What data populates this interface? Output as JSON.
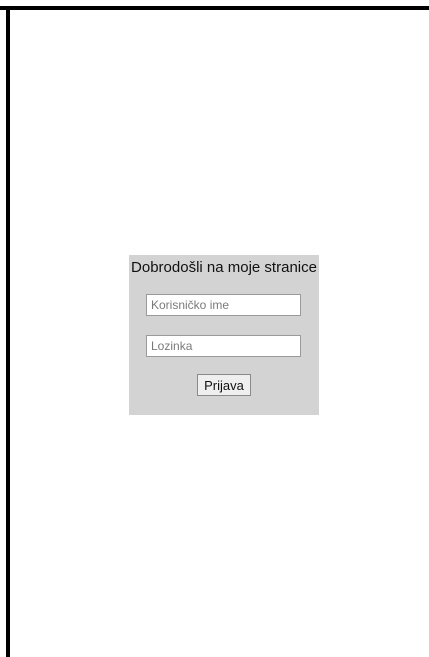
{
  "login": {
    "title": "Dobrodošli na moje stranice",
    "username_placeholder": "Korisničko ime",
    "username_value": "",
    "password_placeholder": "Lozinka",
    "password_value": "",
    "submit_label": "Prijava"
  },
  "colors": {
    "panel_background": "#d3d3d3",
    "frame": "#000000",
    "page_background": "#ffffff"
  }
}
